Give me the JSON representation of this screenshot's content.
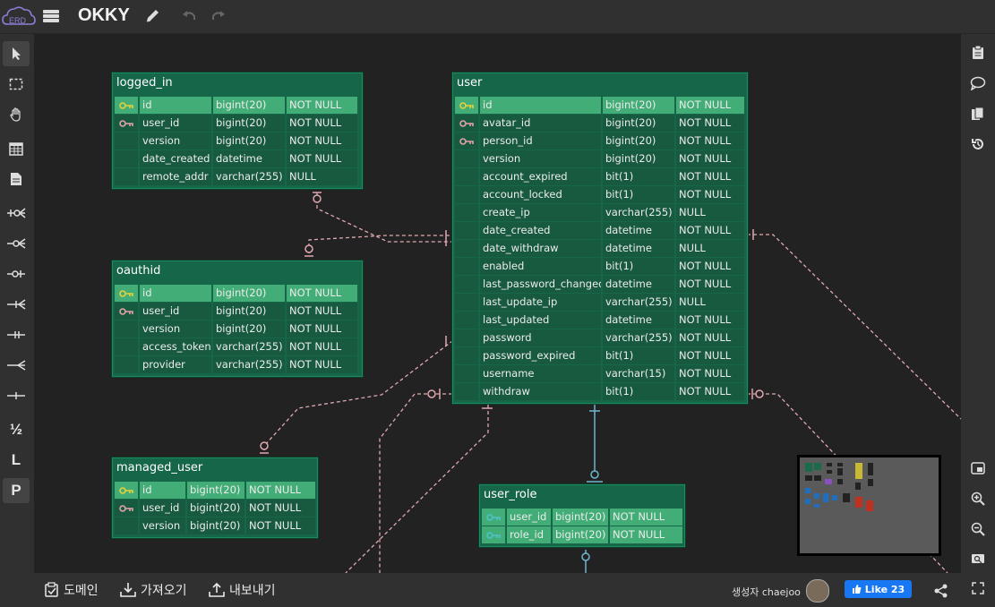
{
  "app": {
    "logo_text": "ERD",
    "project_title": "OKKY"
  },
  "left_tools": [
    {
      "name": "pointer"
    },
    {
      "name": "select-area"
    },
    {
      "name": "hand"
    },
    {
      "name": "table-add"
    },
    {
      "name": "memo-add"
    },
    {
      "name": "relation-zero-one-n"
    },
    {
      "name": "relation-zero-n"
    },
    {
      "name": "relation-zero-one"
    },
    {
      "name": "relation-one-n"
    },
    {
      "name": "relation-one-only"
    },
    {
      "name": "relation-n"
    },
    {
      "name": "relation-one"
    }
  ],
  "left_text_tools": {
    "pk_fk": "½",
    "logical": "L",
    "physical": "P"
  },
  "tables": {
    "logged_in": {
      "name": "logged_in",
      "rows": [
        {
          "key": "pk",
          "col": "id",
          "type": "bigint(20)",
          "null": "NOT NULL"
        },
        {
          "key": "fk",
          "col": "user_id",
          "type": "bigint(20)",
          "null": "NOT NULL"
        },
        {
          "key": "",
          "col": "version",
          "type": "bigint(20)",
          "null": "NOT NULL"
        },
        {
          "key": "",
          "col": "date_created",
          "type": "datetime",
          "null": "NOT NULL"
        },
        {
          "key": "",
          "col": "remote_addr",
          "type": "varchar(255)",
          "null": "NULL"
        }
      ]
    },
    "oauthid": {
      "name": "oauthid",
      "rows": [
        {
          "key": "pk",
          "col": "id",
          "type": "bigint(20)",
          "null": "NOT NULL"
        },
        {
          "key": "fk",
          "col": "user_id",
          "type": "bigint(20)",
          "null": "NOT NULL"
        },
        {
          "key": "",
          "col": "version",
          "type": "bigint(20)",
          "null": "NOT NULL"
        },
        {
          "key": "",
          "col": "access_token",
          "type": "varchar(255)",
          "null": "NOT NULL"
        },
        {
          "key": "",
          "col": "provider",
          "type": "varchar(255)",
          "null": "NOT NULL"
        }
      ]
    },
    "managed_user": {
      "name": "managed_user",
      "rows": [
        {
          "key": "pk",
          "col": "id",
          "type": "bigint(20)",
          "null": "NOT NULL"
        },
        {
          "key": "fk",
          "col": "user_id",
          "type": "bigint(20)",
          "null": "NOT NULL"
        },
        {
          "key": "",
          "col": "version",
          "type": "bigint(20)",
          "null": "NOT NULL"
        }
      ]
    },
    "user": {
      "name": "user",
      "rows": [
        {
          "key": "pk",
          "col": "id",
          "type": "bigint(20)",
          "null": "NOT NULL"
        },
        {
          "key": "fk",
          "col": "avatar_id",
          "type": "bigint(20)",
          "null": "NOT NULL"
        },
        {
          "key": "fk",
          "col": "person_id",
          "type": "bigint(20)",
          "null": "NOT NULL"
        },
        {
          "key": "",
          "col": "version",
          "type": "bigint(20)",
          "null": "NOT NULL"
        },
        {
          "key": "",
          "col": "account_expired",
          "type": "bit(1)",
          "null": "NOT NULL"
        },
        {
          "key": "",
          "col": "account_locked",
          "type": "bit(1)",
          "null": "NOT NULL"
        },
        {
          "key": "",
          "col": "create_ip",
          "type": "varchar(255)",
          "null": "NULL"
        },
        {
          "key": "",
          "col": "date_created",
          "type": "datetime",
          "null": "NOT NULL"
        },
        {
          "key": "",
          "col": "date_withdraw",
          "type": "datetime",
          "null": "NULL"
        },
        {
          "key": "",
          "col": "enabled",
          "type": "bit(1)",
          "null": "NOT NULL"
        },
        {
          "key": "",
          "col": "last_password_changed",
          "type": "datetime",
          "null": "NOT NULL"
        },
        {
          "key": "",
          "col": "last_update_ip",
          "type": "varchar(255)",
          "null": "NULL"
        },
        {
          "key": "",
          "col": "last_updated",
          "type": "datetime",
          "null": "NOT NULL"
        },
        {
          "key": "",
          "col": "password",
          "type": "varchar(255)",
          "null": "NOT NULL"
        },
        {
          "key": "",
          "col": "password_expired",
          "type": "bit(1)",
          "null": "NOT NULL"
        },
        {
          "key": "",
          "col": "username",
          "type": "varchar(15)",
          "null": "NOT NULL"
        },
        {
          "key": "",
          "col": "withdraw",
          "type": "bit(1)",
          "null": "NOT NULL"
        }
      ]
    },
    "user_role": {
      "name": "user_role",
      "rows": [
        {
          "key": "pfk",
          "col": "user_id",
          "type": "bigint(20)",
          "null": "NOT NULL"
        },
        {
          "key": "pfk",
          "col": "role_id",
          "type": "bigint(20)",
          "null": "NOT NULL"
        }
      ]
    }
  },
  "bottom": {
    "domain_label": "도메인",
    "import_label": "가져오기",
    "export_label": "내보내기",
    "author_text": "생성자 chaejoo",
    "like_text": "Like 23"
  },
  "colors": {
    "table_header": "#16664a",
    "selected_row": "#43ad77",
    "pk_key": "#e2d13c",
    "fk_key": "#e3a2a8",
    "pfk_key": "#4fc1c9",
    "relation_pink": "#e0a8b0",
    "relation_blue": "#6fb6cf",
    "like_button": "#1877f2"
  }
}
